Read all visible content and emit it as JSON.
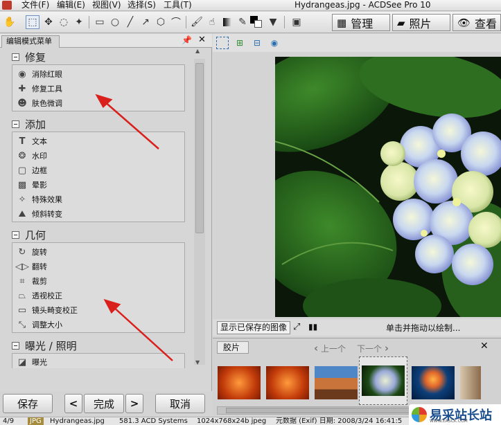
{
  "window": {
    "title": "Hydrangeas.jpg - ACDSee Pro 10",
    "menu": [
      "文件(F)",
      "编辑(E)",
      "视图(V)",
      "选择(S)",
      "工具(T)"
    ]
  },
  "modes": [
    {
      "label": "管理",
      "icon": "grid-icon"
    },
    {
      "label": "照片",
      "icon": "photo-icon"
    },
    {
      "label": "查看",
      "icon": "eye-icon"
    }
  ],
  "panel": {
    "tab": "编辑模式菜单",
    "groups": [
      {
        "title": "修复",
        "items": [
          "消除红眼",
          "修复工具",
          "肤色微调"
        ]
      },
      {
        "title": "添加",
        "items": [
          "文本",
          "水印",
          "边框",
          "晕影",
          "特殊效果",
          "倾斜转变"
        ]
      },
      {
        "title": "几何",
        "items": [
          "旋转",
          "翻转",
          "裁剪",
          "透视校正",
          "镜头畸变校正",
          "调整大小"
        ]
      },
      {
        "title": "曝光 / 照明",
        "items": [
          "曝光"
        ]
      }
    ]
  },
  "buttons": {
    "save": "保存",
    "done": "完成",
    "cancel": "取消",
    "prev": "<",
    "next": ">"
  },
  "viewer": {
    "show_saved": "显示已保存的图像",
    "hint": "单击并拖动以绘制..."
  },
  "filmstrip": {
    "tab": "胶片",
    "prev": "上一个",
    "next": "下一个"
  },
  "statusbar": {
    "index": "4/9",
    "type": "JPG",
    "filename": "Hydrangeas.jpg",
    "size": "581.3 ACD Systems",
    "dims": "1024x768x24b jpeg",
    "date": "元数据 (Exif) 日期: 2008/3/24 16:41:5"
  },
  "watermark": {
    "text": "易采站长站",
    "sub": "WWW.EASCK.COM"
  },
  "colors": {
    "accent": "#2a6fb0",
    "arrow": "#d9201c"
  }
}
